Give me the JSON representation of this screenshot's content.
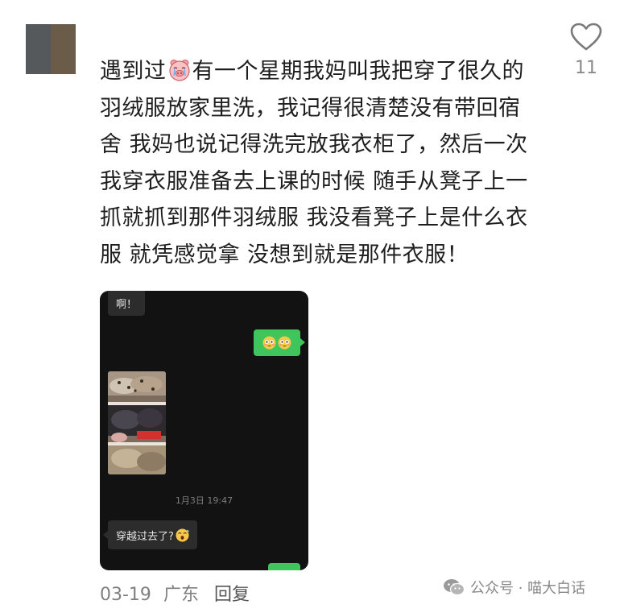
{
  "comment": {
    "like_count": "11",
    "text_segments": {
      "before_emoji": "遇到过",
      "after_emoji": "有一个星期我妈叫我把穿了很久的羽绒服放家里洗，我记得很清楚没有带回宿舍 我妈也说记得洗完放我衣柜了，然后一次我穿衣服准备去上课的时候 随手从凳子上一抓就抓到那件羽绒服 我没看凳子上是什么衣服 就凭感觉拿 没想到就是那件衣服！"
    },
    "inline_emoji": "crying-pig-emoji",
    "date": "03-19",
    "location": "广东",
    "reply_label": "回复"
  },
  "chat_screenshot": {
    "first_message": "啊！",
    "sent_emojis": [
      "flushed-face-emoji",
      "flushed-face-emoji"
    ],
    "timestamp": "1月3日 19:47",
    "last_message": "穿越过去了?",
    "last_message_emoji": "shocked-face-emoji"
  },
  "watermark": {
    "text": "公众号 · 喵大白话"
  },
  "colors": {
    "chat_bg": "#121212",
    "bubble_green": "#3fc55c",
    "bubble_gray": "#2c2c2c",
    "meta_gray": "#7f7f7f"
  }
}
